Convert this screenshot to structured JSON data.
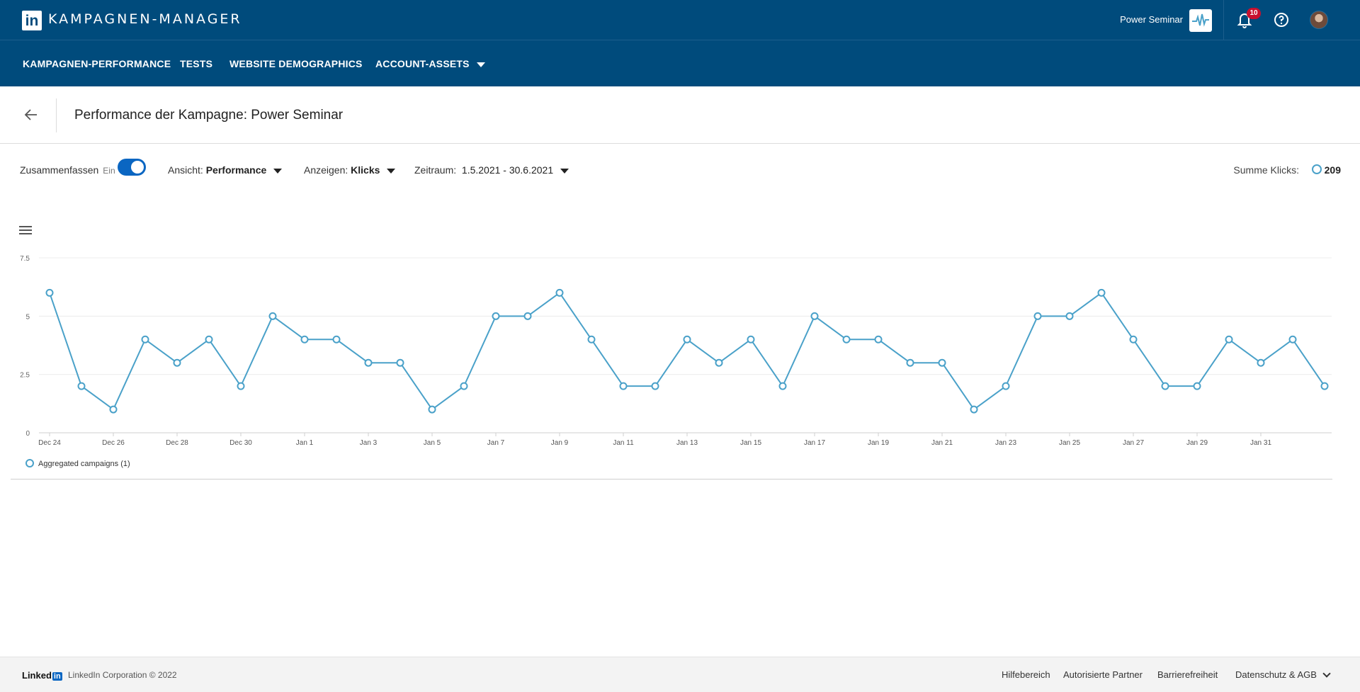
{
  "topbar": {
    "logo_text": "in",
    "app_title": "KAMPAGNEN-MANAGER",
    "account_name": "Power Seminar",
    "notifications_count": "10"
  },
  "nav": {
    "items": [
      {
        "label": "KAMPAGNEN-PERFORMANCE"
      },
      {
        "label": "TESTS"
      },
      {
        "label": "WEBSITE DEMOGRAPHICS"
      },
      {
        "label": "ACCOUNT-ASSETS"
      }
    ]
  },
  "page": {
    "title": "Performance der Kampagne: Power Seminar"
  },
  "controls": {
    "summarize_label": "Zusammenfassen",
    "summarize_state": "Ein",
    "view_label": "Ansicht:",
    "view_value": "Performance",
    "show_label": "Anzeigen:",
    "show_value": "Klicks",
    "period_label": "Zeitraum:",
    "period_value": "1.5.2021 - 30.6.2021",
    "sum_label": "Summe Klicks:",
    "sum_value": "209"
  },
  "chart_data": {
    "type": "line",
    "title": "",
    "xlabel": "",
    "ylabel": "",
    "ylim": [
      0,
      7.5
    ],
    "y_ticks": [
      "0",
      "2.5",
      "5",
      "7.5"
    ],
    "x_tick_labels": [
      "Dec 24",
      "Dec 26",
      "Dec 28",
      "Dec 30",
      "Jan 1",
      "Jan 3",
      "Jan 5",
      "Jan 7",
      "Jan 9",
      "Jan 11",
      "Jan 13",
      "Jan 15",
      "Jan 17",
      "Jan 19",
      "Jan 21",
      "Jan 23",
      "Jan 25",
      "Jan 27",
      "Jan 29",
      "Jan 31"
    ],
    "grid": true,
    "legend_position": "bottom-left",
    "series": [
      {
        "name": "Aggregated campaigns (1)",
        "color": "#4aa1c9",
        "values": [
          6,
          2,
          1,
          4,
          3,
          4,
          2,
          5,
          4,
          4,
          3,
          3,
          1,
          2,
          5,
          5,
          6,
          4,
          2,
          2,
          4,
          3,
          4,
          2,
          5,
          4,
          4,
          3,
          3,
          1,
          2,
          5,
          5,
          6,
          4,
          2,
          2,
          4,
          3,
          4,
          2
        ]
      }
    ]
  },
  "footer": {
    "logo_word": "Linked",
    "logo_in": "in",
    "copyright": "LinkedIn Corporation © 2022",
    "links": [
      {
        "label": "Hilfebereich"
      },
      {
        "label": "Autorisierte Partner"
      },
      {
        "label": "Barrierefreiheit"
      },
      {
        "label": "Datenschutz & AGB"
      }
    ]
  }
}
